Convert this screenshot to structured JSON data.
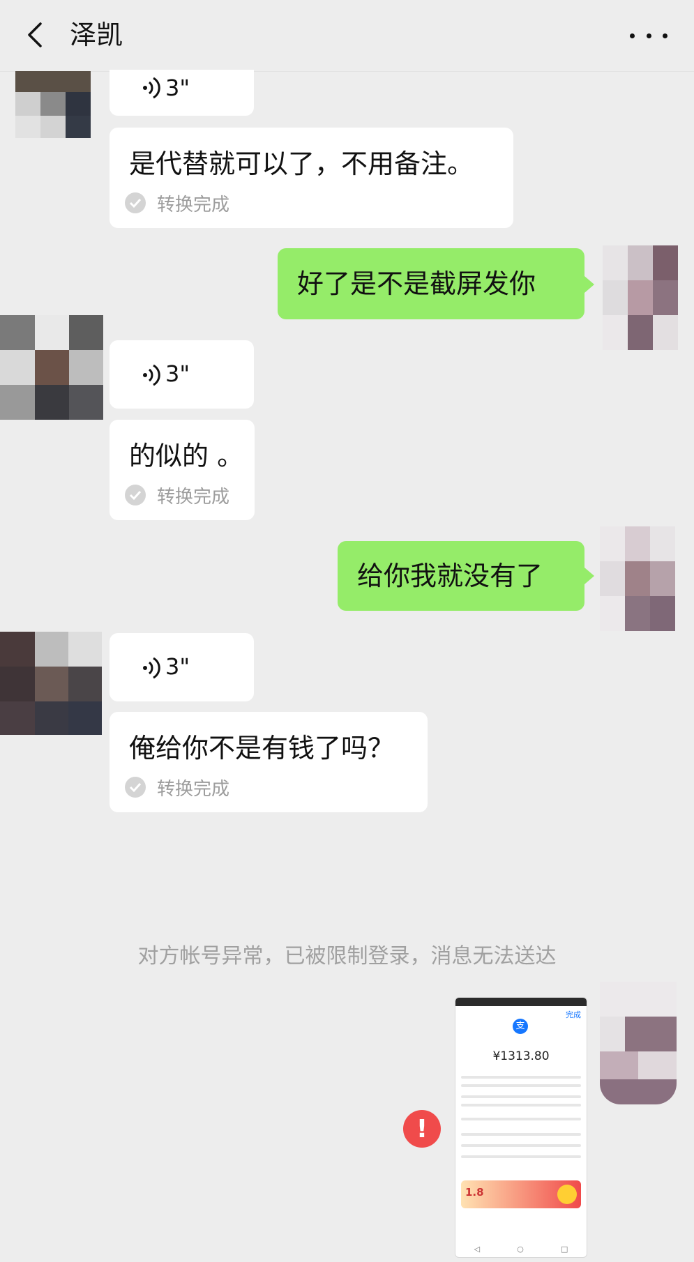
{
  "header": {
    "title": "泽凯"
  },
  "messages": {
    "voice1_duration": "3\"",
    "text1": "是代替就可以了，不用备注。",
    "sent1": "好了是不是截屏发你",
    "voice2_duration": "3\"",
    "text2": "的似的 。",
    "sent2": "给你我就没有了",
    "voice3_duration": "3\"",
    "text3": "俺给你不是有钱了吗？",
    "converted_label": "转换完成"
  },
  "system_notice": "对方帐号异常，已被限制登录，消息无法送达",
  "image_message": {
    "amount": "¥1313.80",
    "done_label": "完成",
    "banner_value": "1.8"
  },
  "colors": {
    "background": "#ededed",
    "sent_bubble": "#95ec69",
    "received_bubble": "#ffffff",
    "error": "#f04b4b"
  },
  "icons": [
    "back-arrow-icon",
    "more-icon",
    "voice-icon",
    "check-circle-icon",
    "error-icon"
  ]
}
